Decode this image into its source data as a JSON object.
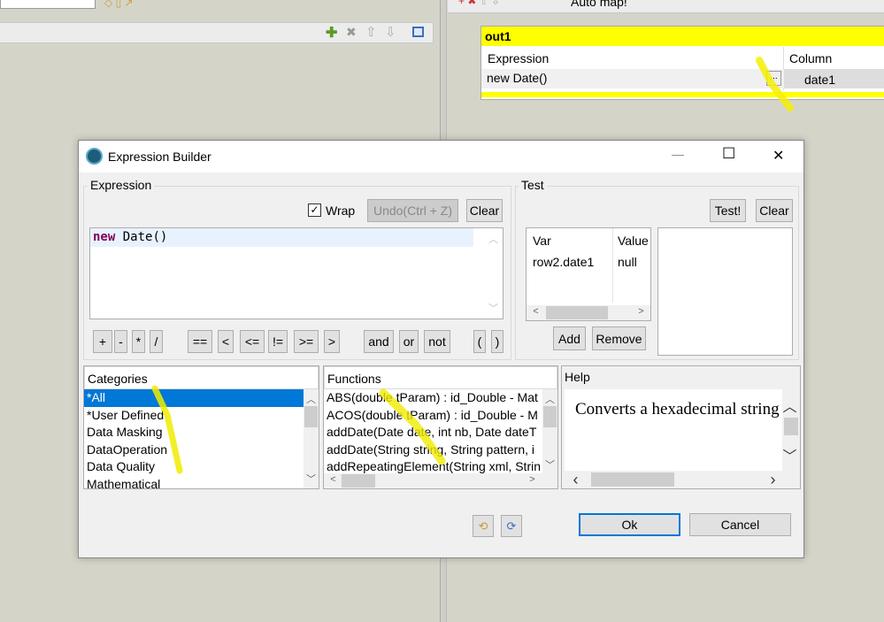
{
  "background": {
    "left_toolbar_icons": [
      "add-icon",
      "delete-icon",
      "move-up-icon",
      "move-down-icon",
      "window-icon"
    ],
    "right_toolbar_label": "Auto map!",
    "output_table": {
      "name": "out1",
      "headers": [
        "Expression",
        "Column"
      ],
      "rows": [
        {
          "expression": "new Date()",
          "button": "...",
          "column": "date1"
        }
      ]
    }
  },
  "dialog": {
    "title": "Expression Builder",
    "controls": {
      "minimize": "—",
      "maximize": "☐",
      "close": "✕"
    },
    "expression": {
      "legend": "Expression",
      "wrap_label": "Wrap",
      "wrap_checked": true,
      "undo_label": "Undo(Ctrl + Z)",
      "clear_label": "Clear",
      "code_keyword": "new",
      "code_rest": " Date()",
      "operators": [
        "+",
        "-",
        "*",
        "/",
        "==",
        "<",
        "<=",
        "!=",
        ">=",
        ">",
        "and",
        "or",
        "not",
        "(",
        ")"
      ]
    },
    "test": {
      "legend": "Test",
      "test_label": "Test!",
      "clear_label": "Clear",
      "headers": [
        "Var",
        "Value"
      ],
      "rows": [
        {
          "var": "row2.date1",
          "value": "null"
        }
      ],
      "add_label": "Add",
      "remove_label": "Remove"
    },
    "categories": {
      "header": "Categories",
      "selected": "*All",
      "items": [
        "*All",
        "*User Defined",
        "Data Masking",
        "DataOperation",
        "Data Quality",
        "Mathematical"
      ]
    },
    "functions": {
      "header": "Functions",
      "items": [
        "ABS(double tParam) : id_Double - Mat",
        "ACOS(double tParam) : id_Double - M",
        "addDate(Date date, int nb, Date dateT",
        "addDate(String string, String pattern, i",
        "addRepeatingElement(String xml, Strin"
      ]
    },
    "help": {
      "header": "Help",
      "text": "Converts a hexadecimal string"
    },
    "footer": {
      "import_icon": "import-icon",
      "export_icon": "export-icon",
      "ok_label": "Ok",
      "cancel_label": "Cancel"
    }
  },
  "colors": {
    "selection": "#0078d7",
    "highlight": "#ffff00",
    "keyword": "#7f0055"
  }
}
